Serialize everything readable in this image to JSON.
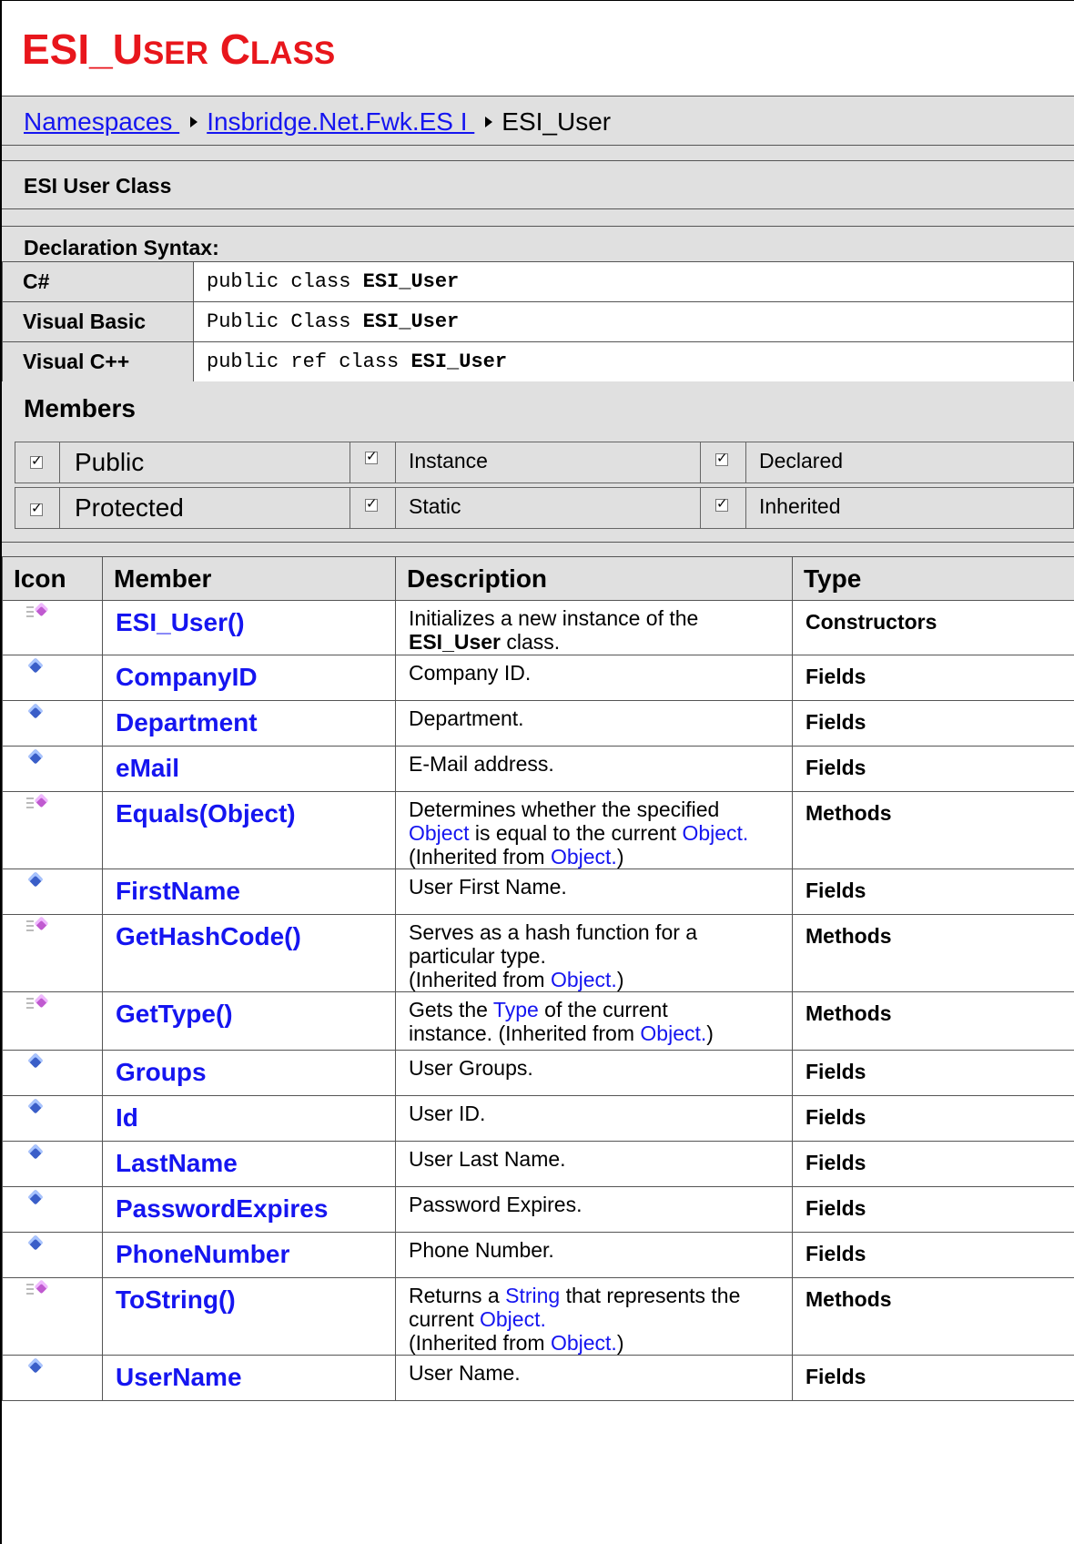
{
  "title": {
    "main_first": "ESI_U",
    "sc1": "SER",
    "space": " C",
    "sc2": "LASS"
  },
  "breadcrumb": {
    "items": [
      "Namespaces ",
      "Insbridge.Net.Fwk.ES I "
    ],
    "current": "ESI_User"
  },
  "summary": "ESI User Class",
  "declaration": {
    "heading": "Declaration Syntax:",
    "rows": [
      {
        "lang": "C#",
        "prefix": "public class ",
        "name": "ESI_User"
      },
      {
        "lang": "Visual Basic",
        "prefix": "Public Class ",
        "name": "ESI_User"
      },
      {
        "lang": "Visual C++",
        "prefix": "public ref class ",
        "name": "ESI_User"
      }
    ]
  },
  "members_heading": "Members",
  "filters": {
    "public": "Public",
    "protected": "Protected",
    "instance": "Instance",
    "static": "Static",
    "declared": "Declared",
    "inherited": "Inherited"
  },
  "table": {
    "headers": [
      "Icon",
      "Member",
      "Description",
      "Type"
    ],
    "rows": [
      {
        "icon": "method-icon",
        "name": "ESI_User()",
        "desc": [
          [
            "t",
            "Initializes a new instance of the "
          ],
          [
            "br"
          ],
          [
            "b",
            "ESI_User"
          ],
          [
            "t",
            " class."
          ]
        ],
        "type": "Constructors"
      },
      {
        "icon": "field-icon",
        "name": "CompanyID",
        "desc": [
          [
            "t",
            "Company ID."
          ]
        ],
        "type": "Fields"
      },
      {
        "icon": "field-icon",
        "name": "Department",
        "desc": [
          [
            "t",
            "Department."
          ]
        ],
        "type": "Fields"
      },
      {
        "icon": "field-icon",
        "name": "eMail",
        "desc": [
          [
            "t",
            "E-Mail address."
          ]
        ],
        "type": "Fields"
      },
      {
        "icon": "method-icon",
        "name": "Equals(Object)",
        "desc": [
          [
            "t",
            "Determines whether the specified "
          ],
          [
            "br"
          ],
          [
            "a",
            "Object"
          ],
          [
            "t",
            " is equal to the current "
          ],
          [
            "a",
            "Object."
          ],
          [
            "br"
          ],
          [
            "t",
            "(Inherited from "
          ],
          [
            "a",
            "Object."
          ],
          [
            "t",
            ")"
          ]
        ],
        "type": "Methods"
      },
      {
        "icon": "field-icon",
        "name": "FirstName",
        "desc": [
          [
            "t",
            "User First Name."
          ]
        ],
        "type": "Fields"
      },
      {
        "icon": "method-icon",
        "name": "GetHashCode()",
        "desc": [
          [
            "t",
            "Serves as a hash function for a "
          ],
          [
            "br"
          ],
          [
            "t",
            "particular type."
          ],
          [
            "br"
          ],
          [
            "t",
            "(Inherited from "
          ],
          [
            "a",
            "Object."
          ],
          [
            "t",
            ")"
          ]
        ],
        "type": "Methods"
      },
      {
        "icon": "method-icon",
        "name": "GetType()",
        "desc": [
          [
            "t",
            "Gets the "
          ],
          [
            "a",
            "Type"
          ],
          [
            "t",
            " of the current "
          ],
          [
            "br"
          ],
          [
            "t",
            "instance. (Inherited from "
          ],
          [
            "a",
            "Object."
          ],
          [
            "t",
            ")"
          ]
        ],
        "type": "Methods"
      },
      {
        "icon": "field-icon",
        "name": "Groups",
        "desc": [
          [
            "t",
            "User Groups."
          ]
        ],
        "type": "Fields"
      },
      {
        "icon": "field-icon",
        "name": "Id",
        "desc": [
          [
            "t",
            "User ID."
          ]
        ],
        "type": "Fields"
      },
      {
        "icon": "field-icon",
        "name": "LastName",
        "desc": [
          [
            "t",
            "User Last Name."
          ]
        ],
        "type": "Fields"
      },
      {
        "icon": "field-icon",
        "name": "PasswordExpires",
        "desc": [
          [
            "t",
            "Password Expires."
          ]
        ],
        "type": "Fields"
      },
      {
        "icon": "field-icon",
        "name": "PhoneNumber",
        "desc": [
          [
            "t",
            "Phone Number."
          ]
        ],
        "type": "Fields"
      },
      {
        "icon": "method-icon",
        "name": "ToString()",
        "desc": [
          [
            "t",
            "Returns a "
          ],
          [
            "a",
            "String"
          ],
          [
            "t",
            " that represents the "
          ],
          [
            "br"
          ],
          [
            "t",
            "current "
          ],
          [
            "a",
            "Object."
          ],
          [
            "br"
          ],
          [
            "t",
            "(Inherited from "
          ],
          [
            "a",
            "Object."
          ],
          [
            "t",
            ")"
          ]
        ],
        "type": "Methods"
      },
      {
        "icon": "field-icon",
        "name": "UserName",
        "desc": [
          [
            "t",
            "User Name."
          ]
        ],
        "type": "Fields"
      }
    ]
  }
}
